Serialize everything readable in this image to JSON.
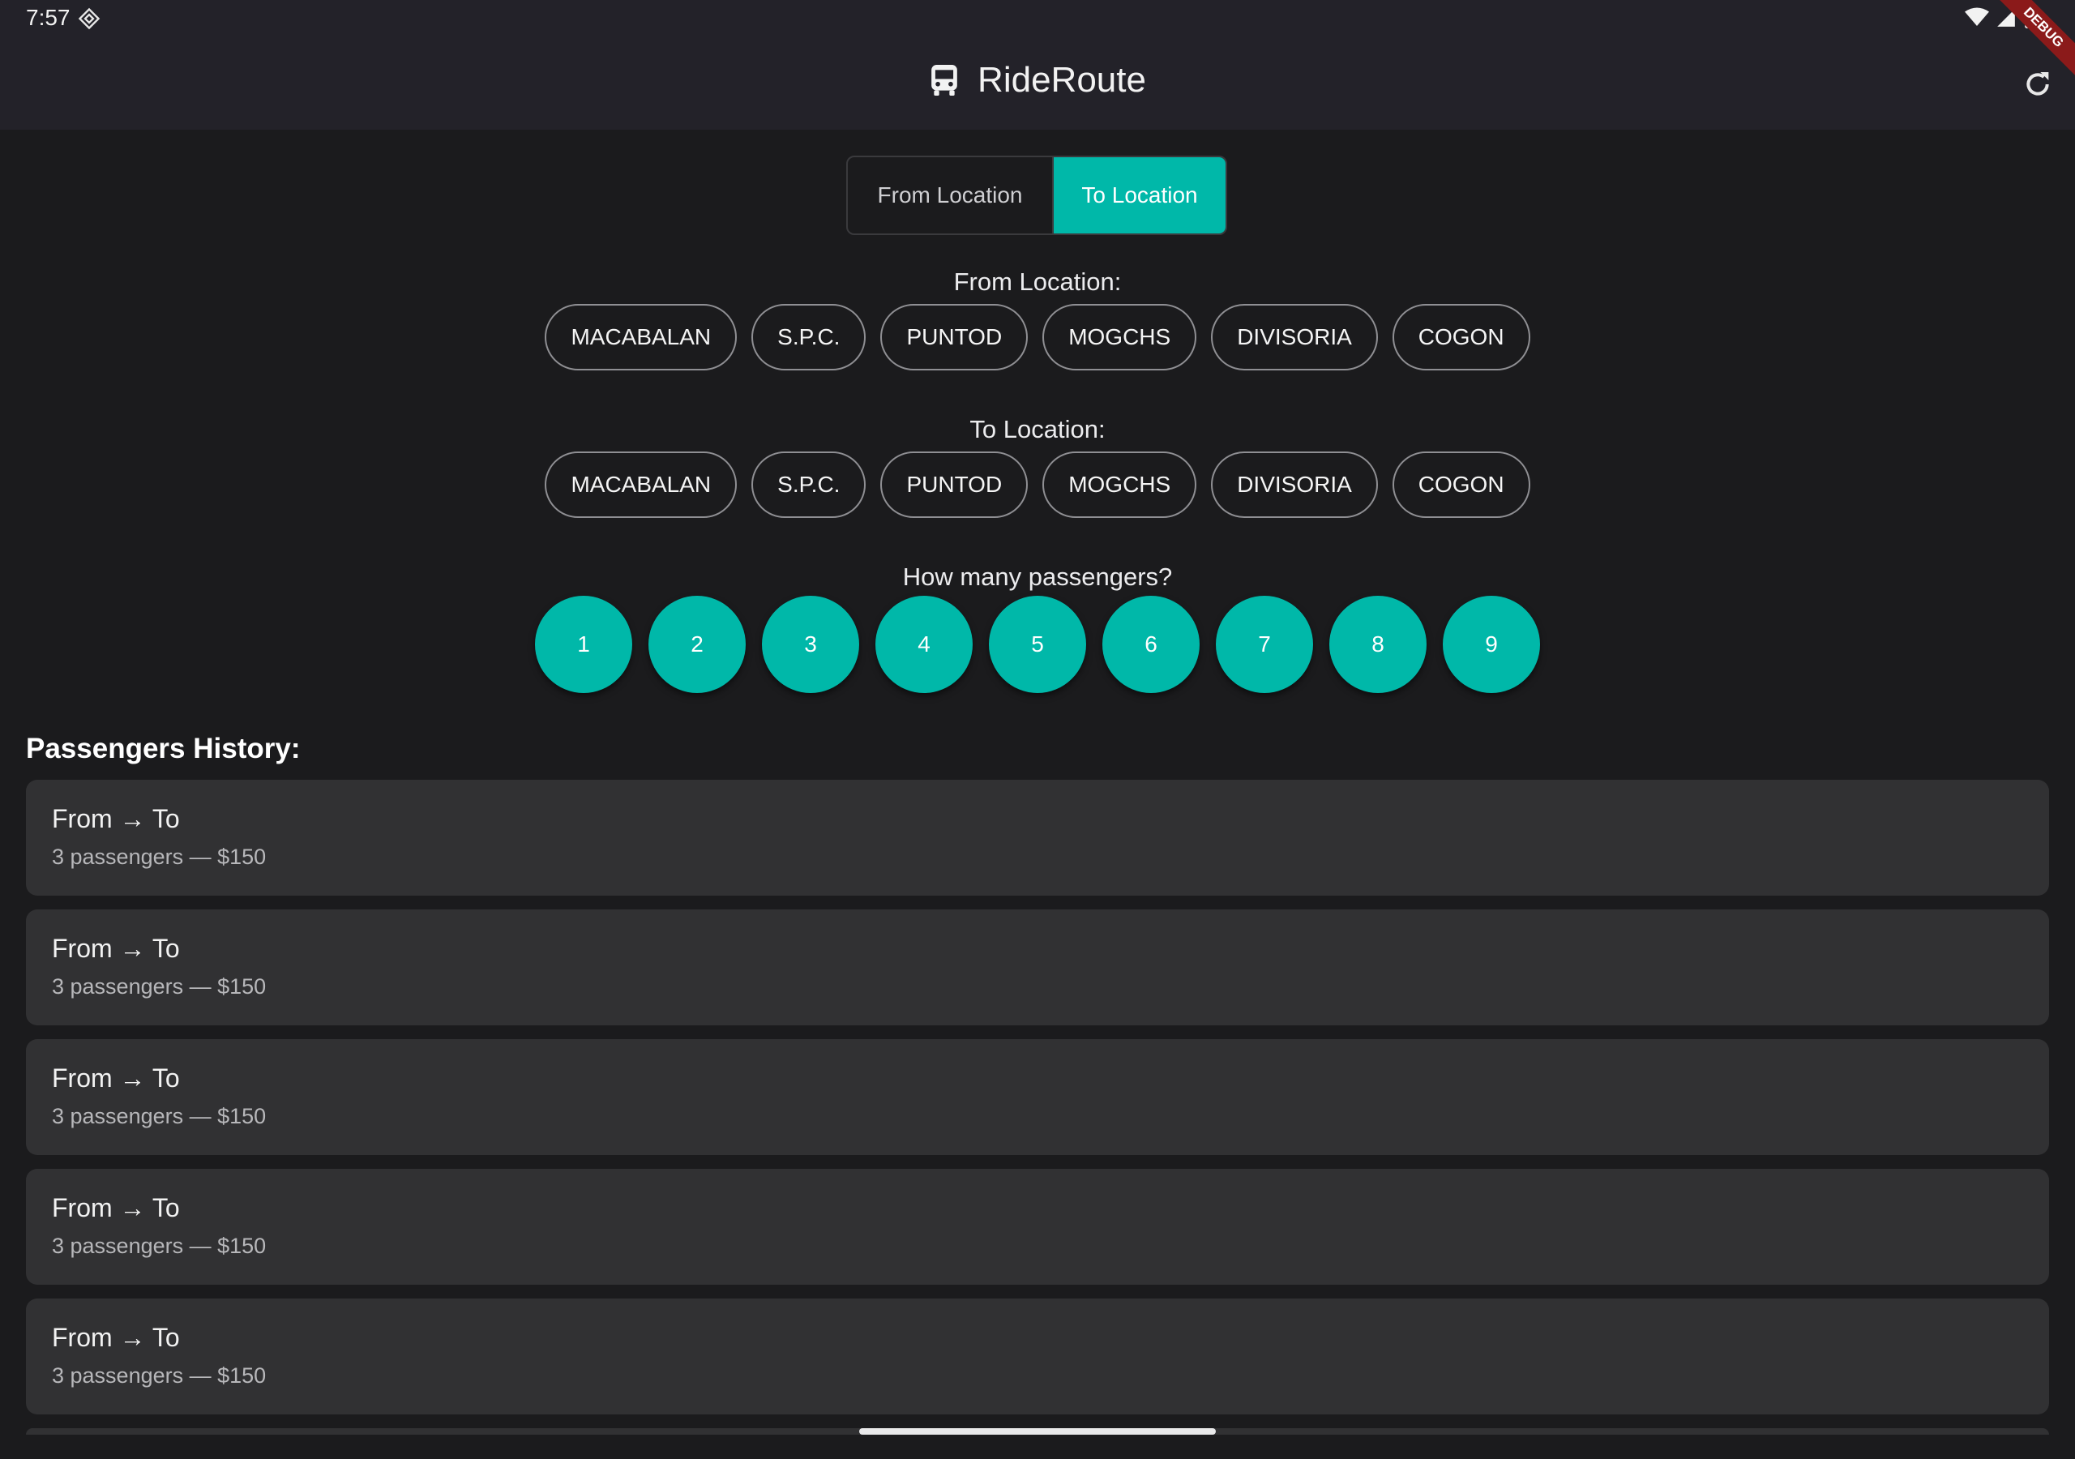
{
  "status": {
    "time": "7:57"
  },
  "appbar": {
    "title": "RideRoute",
    "debug_label": "DEBUG"
  },
  "toggle": {
    "from_label": "From Location",
    "to_label": "To Location",
    "selected": "To Location"
  },
  "from_section": {
    "label": "From Location:",
    "locations": [
      "MACABALAN",
      "S.P.C.",
      "PUNTOD",
      "MOGCHS",
      "DIVISORIA",
      "COGON"
    ]
  },
  "to_section": {
    "label": "To Location:",
    "locations": [
      "MACABALAN",
      "S.P.C.",
      "PUNTOD",
      "MOGCHS",
      "DIVISORIA",
      "COGON"
    ]
  },
  "passengers": {
    "label": "How many passengers?",
    "options": [
      "1",
      "2",
      "3",
      "4",
      "5",
      "6",
      "7",
      "8",
      "9"
    ]
  },
  "history": {
    "title": "Passengers History:",
    "items": [
      {
        "route": "From → To",
        "detail": "3 passengers — $150"
      },
      {
        "route": "From → To",
        "detail": "3 passengers — $150"
      },
      {
        "route": "From → To",
        "detail": "3 passengers — $150"
      },
      {
        "route": "From → To",
        "detail": "3 passengers — $150"
      },
      {
        "route": "From → To",
        "detail": "3 passengers — $150"
      }
    ]
  },
  "colors": {
    "accent": "#00b8a9",
    "background": "#1b1b1d",
    "appbar": "#232229",
    "card": "#313133"
  }
}
